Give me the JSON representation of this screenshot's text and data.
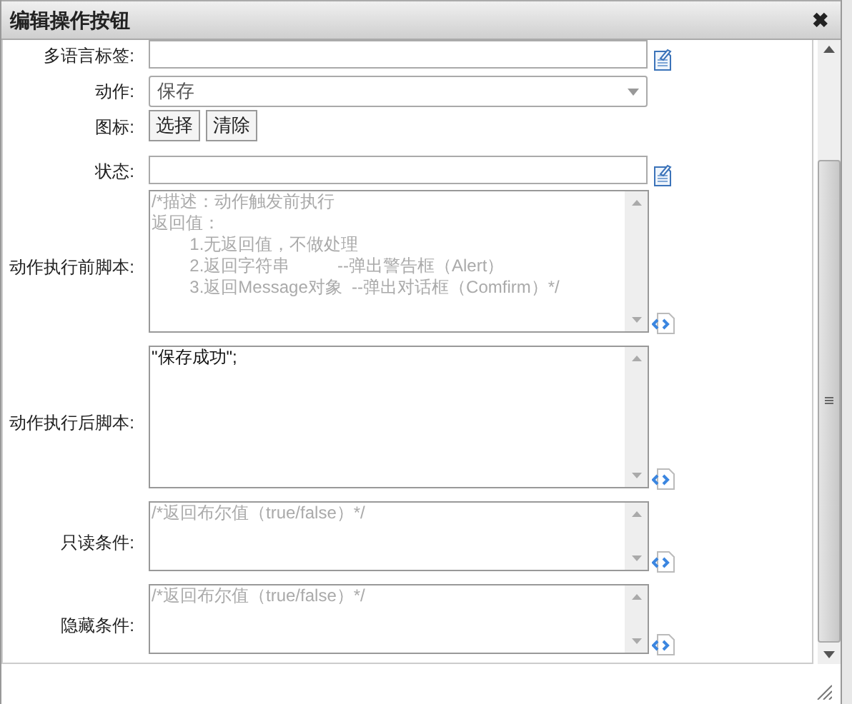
{
  "window": {
    "title": "编辑操作按钮",
    "close": "✖"
  },
  "fields": [
    {
      "kind": "text",
      "label": "多语言标签:"
    },
    {
      "kind": "select",
      "label": "动作:",
      "value": "保存"
    },
    {
      "kind": "buttons",
      "label": "图标:",
      "buttons": [
        "选择",
        "清除"
      ]
    },
    {
      "kind": "text",
      "label": "状态:"
    },
    {
      "kind": "script",
      "label": "动作执行前脚本:",
      "placeholder": [
        "/*描述：动作触发前执行",
        "返回值：",
        "        1.无返回值，不做处理",
        "        2.返回字符串          --弹出警告框（Alert）",
        "        3.返回Message对象  --弹出对话框（Comfirm）*/"
      ]
    },
    {
      "kind": "script",
      "label": "动作执行后脚本:",
      "value": "\"保存成功\";"
    },
    {
      "kind": "condition",
      "label": "只读条件:",
      "placeholder": [
        "/*返回布尔值（true/false）*/"
      ]
    },
    {
      "kind": "condition",
      "label": "隐藏条件:",
      "placeholder": [
        "/*返回布尔值（true/false）*/"
      ]
    }
  ]
}
